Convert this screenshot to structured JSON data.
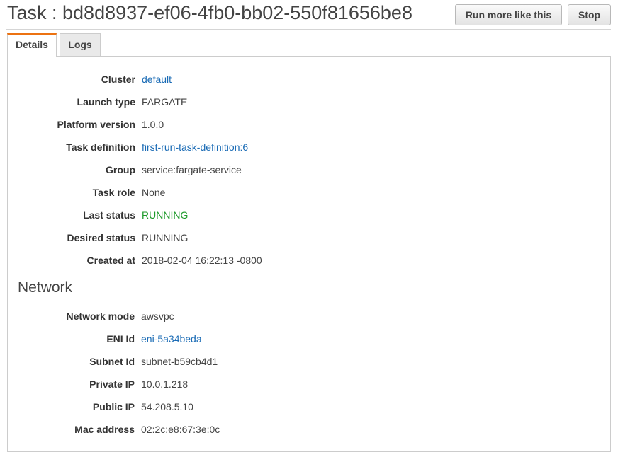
{
  "header": {
    "title": "Task : bd8d8937-ef06-4fb0-bb02-550f81656be8",
    "run_more_label": "Run more like this",
    "stop_label": "Stop"
  },
  "tabs": [
    {
      "label": "Details",
      "active": true
    },
    {
      "label": "Logs",
      "active": false
    }
  ],
  "details": [
    {
      "label": "Cluster",
      "value": "default",
      "link": true
    },
    {
      "label": "Launch type",
      "value": "FARGATE"
    },
    {
      "label": "Platform version",
      "value": "1.0.0"
    },
    {
      "label": "Task definition",
      "value": "first-run-task-definition:6",
      "link": true
    },
    {
      "label": "Group",
      "value": "service:fargate-service"
    },
    {
      "label": "Task role",
      "value": "None"
    },
    {
      "label": "Last status",
      "value": "RUNNING",
      "status_color": "#1d9a2a"
    },
    {
      "label": "Desired status",
      "value": "RUNNING"
    },
    {
      "label": "Created at",
      "value": "2018-02-04 16:22:13 -0800"
    }
  ],
  "network": {
    "title": "Network",
    "rows": [
      {
        "label": "Network mode",
        "value": "awsvpc"
      },
      {
        "label": "ENI Id",
        "value": "eni-5a34beda",
        "link": true
      },
      {
        "label": "Subnet Id",
        "value": "subnet-b59cb4d1"
      },
      {
        "label": "Private IP",
        "value": "10.0.1.218"
      },
      {
        "label": "Public IP",
        "value": "54.208.5.10"
      },
      {
        "label": "Mac address",
        "value": "02:2c:e8:67:3e:0c"
      }
    ]
  },
  "colors": {
    "accent_tab": "#ec7211",
    "link": "#1a6bb5",
    "status_running": "#1d9a2a"
  }
}
